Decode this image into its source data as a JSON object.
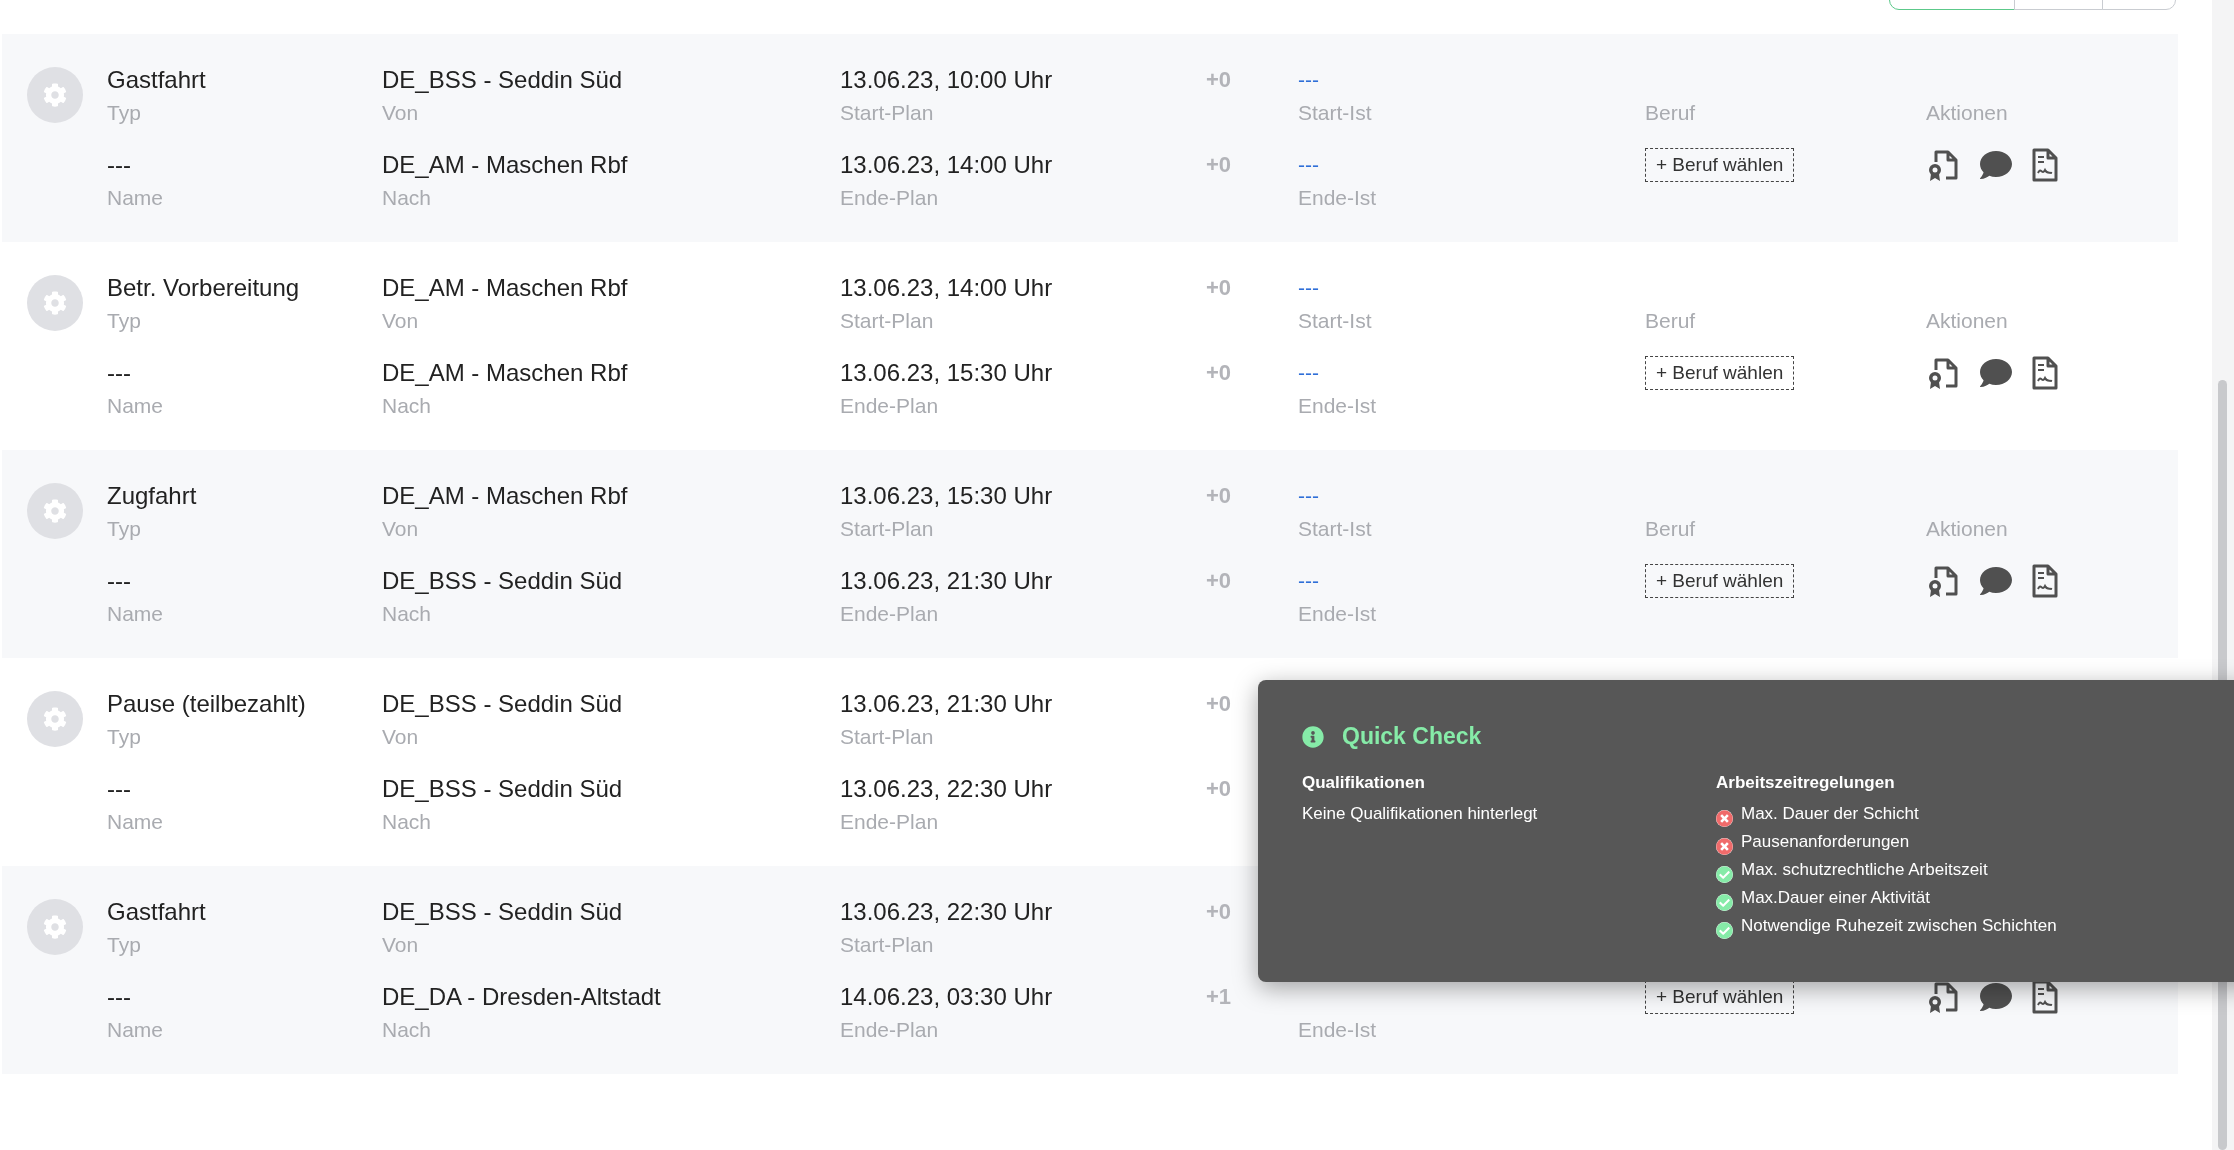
{
  "segment_buttons": [
    {
      "selected": true
    },
    {
      "selected": false
    },
    {
      "selected": false
    }
  ],
  "rows": [
    {
      "typ": "Gastfahrt",
      "typ_label": "Typ",
      "name": "---",
      "name_label": "Name",
      "von": "DE_BSS - Seddin Süd",
      "von_label": "Von",
      "nach": "DE_AM - Maschen Rbf",
      "nach_label": "Nach",
      "start_plan": "13.06.23, 10:00 Uhr",
      "start_plan_label": "Start-Plan",
      "end_plan": "13.06.23, 14:00 Uhr",
      "end_plan_label": "Ende-Plan",
      "start_delta": "+0",
      "end_delta": "+0",
      "start_ist": "---",
      "start_ist_label": "Start-Ist",
      "end_ist": "---",
      "end_ist_label": "Ende-Ist",
      "beruf_label": "Beruf",
      "beruf_button": "+ Beruf wählen",
      "actions_label": "Aktionen",
      "actions": [
        {
          "kind": "certificate"
        },
        {
          "kind": "comment"
        },
        {
          "kind": "signature"
        }
      ]
    },
    {
      "typ": "Betr. Vorbereitung",
      "typ_label": "Typ",
      "name": "---",
      "name_label": "Name",
      "von": "DE_AM - Maschen Rbf",
      "von_label": "Von",
      "nach": "DE_AM - Maschen Rbf",
      "nach_label": "Nach",
      "start_plan": "13.06.23, 14:00 Uhr",
      "start_plan_label": "Start-Plan",
      "end_plan": "13.06.23, 15:30 Uhr",
      "end_plan_label": "Ende-Plan",
      "start_delta": "+0",
      "end_delta": "+0",
      "start_ist": "---",
      "start_ist_label": "Start-Ist",
      "end_ist": "---",
      "end_ist_label": "Ende-Ist",
      "beruf_label": "Beruf",
      "beruf_button": "+ Beruf wählen",
      "actions_label": "Aktionen",
      "actions": [
        {
          "kind": "certificate"
        },
        {
          "kind": "comment"
        },
        {
          "kind": "signature"
        }
      ]
    },
    {
      "typ": "Zugfahrt",
      "typ_label": "Typ",
      "name": "---",
      "name_label": "Name",
      "von": "DE_AM - Maschen Rbf",
      "von_label": "Von",
      "nach": "DE_BSS - Seddin Süd",
      "nach_label": "Nach",
      "start_plan": "13.06.23, 15:30 Uhr",
      "start_plan_label": "Start-Plan",
      "end_plan": "13.06.23, 21:30 Uhr",
      "end_plan_label": "Ende-Plan",
      "start_delta": "+0",
      "end_delta": "+0",
      "start_ist": "---",
      "start_ist_label": "Start-Ist",
      "end_ist": "---",
      "end_ist_label": "Ende-Ist",
      "beruf_label": "Beruf",
      "beruf_button": "+ Beruf wählen",
      "actions_label": "Aktionen",
      "actions": [
        {
          "kind": "certificate"
        },
        {
          "kind": "comment"
        },
        {
          "kind": "signature"
        }
      ]
    },
    {
      "typ": "Pause (teilbezahlt)",
      "typ_label": "Typ",
      "name": "---",
      "name_label": "Name",
      "von": "DE_BSS - Seddin Süd",
      "von_label": "Von",
      "nach": "DE_BSS - Seddin Süd",
      "nach_label": "Nach",
      "start_plan": "13.06.23, 21:30 Uhr",
      "start_plan_label": "Start-Plan",
      "end_plan": "13.06.23, 22:30 Uhr",
      "end_plan_label": "Ende-Plan",
      "start_delta": "+0",
      "end_delta": "+0"
    },
    {
      "typ": "Gastfahrt",
      "typ_label": "Typ",
      "name": "---",
      "name_label": "Name",
      "von": "DE_BSS - Seddin Süd",
      "von_label": "Von",
      "nach": "DE_DA - Dresden-Altstadt",
      "nach_label": "Nach",
      "start_plan": "13.06.23, 22:30 Uhr",
      "start_plan_label": "Start-Plan",
      "end_plan": "14.06.23, 03:30 Uhr",
      "end_plan_label": "Ende-Plan",
      "start_delta": "+0",
      "end_delta": "+1",
      "end_ist_label": "Ende-Ist",
      "beruf_button": "+ Beruf wählen",
      "actions": [
        {
          "kind": "certificate"
        },
        {
          "kind": "comment"
        },
        {
          "kind": "signature"
        }
      ]
    }
  ],
  "quick_check": {
    "title": "Quick Check",
    "qualifications": {
      "heading": "Qualifikationen",
      "text": "Keine Qualifikationen hinterlegt"
    },
    "rules": {
      "heading": "Arbeitszeitregelungen",
      "items": [
        {
          "text": "Max. Dauer der Schicht",
          "passed": false
        },
        {
          "text": "Pausenanforderungen",
          "passed": false
        },
        {
          "text": "Max. schutzrechtliche Arbeitszeit",
          "passed": true
        },
        {
          "text": "Max.Dauer einer Aktivität",
          "passed": true
        },
        {
          "text": "Notwendige Ruhezeit zwischen Schichten",
          "passed": true
        }
      ]
    }
  }
}
